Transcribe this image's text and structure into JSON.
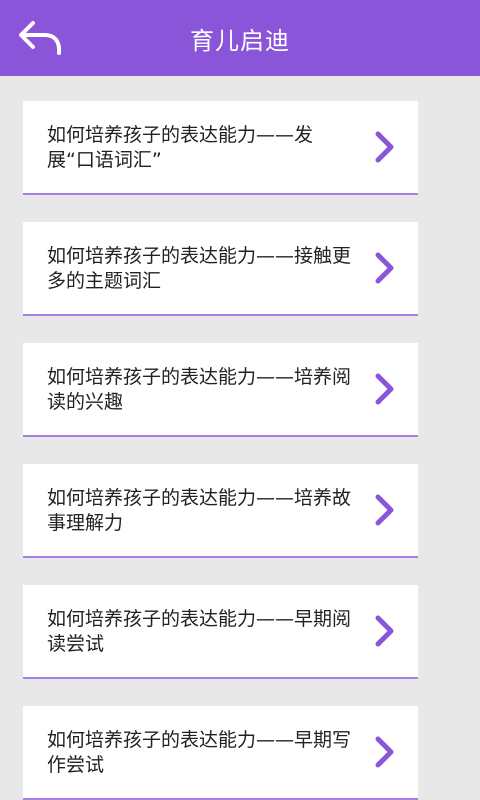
{
  "header": {
    "title": "育儿启迪",
    "back_icon": "back-arrow-icon",
    "background_color": "#8a55d8"
  },
  "list": {
    "items": [
      {
        "label": "如何培养孩子的表达能力——发展“口语词汇”"
      },
      {
        "label": "如何培养孩子的表达能力——接触更多的主题词汇"
      },
      {
        "label": "如何培养孩子的表达能力——培养阅读的兴趣"
      },
      {
        "label": "如何培养孩子的表达能力——培养故事理解力"
      },
      {
        "label": "如何培养孩子的表达能力——早期阅读尝试"
      },
      {
        "label": "如何培养孩子的表达能力——早期写作尝试"
      }
    ],
    "item_icon": "chevron-right-icon",
    "accent_color": "#8a55d8"
  }
}
